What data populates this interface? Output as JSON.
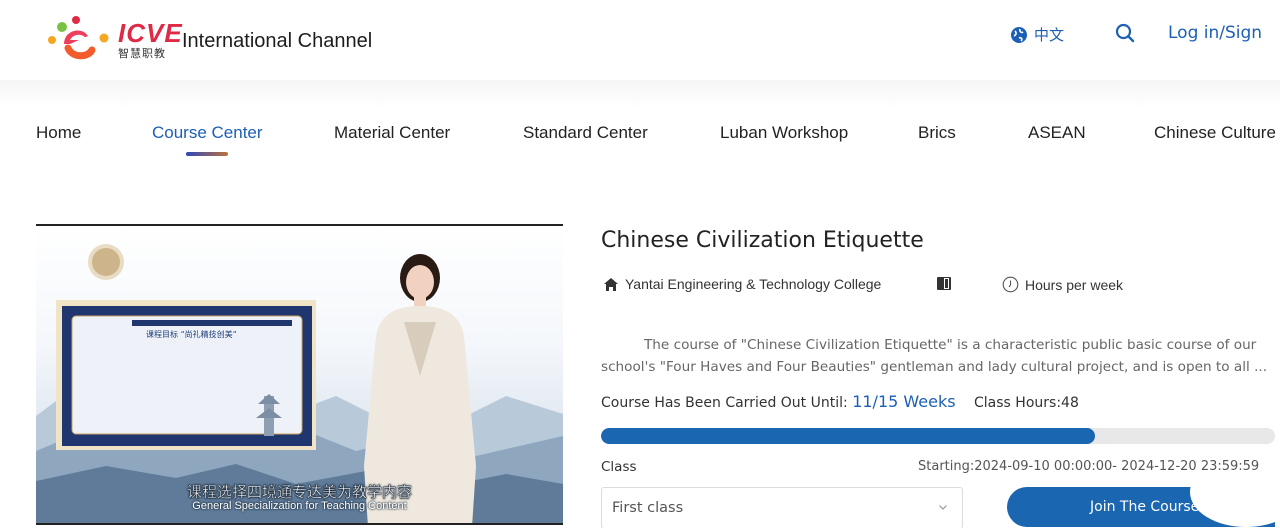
{
  "header": {
    "brand_name": "ICVE",
    "brand_sub": "智慧职教",
    "site_title": "International Channel",
    "language_label": "中文",
    "login_label": "Log in/Sign"
  },
  "nav": {
    "items": [
      {
        "label": "Home"
      },
      {
        "label": "Course Center",
        "active": true
      },
      {
        "label": "Material Center"
      },
      {
        "label": "Standard Center"
      },
      {
        "label": "Luban Workshop"
      },
      {
        "label": "Brics"
      },
      {
        "label": "ASEAN"
      },
      {
        "label": "Chinese Culture"
      }
    ]
  },
  "video": {
    "slide_title": "课程目标 “尚礼精技创美”",
    "subtitle_cn": "课程选择四境通专达美为教学内容",
    "subtitle_en": "General Specialization for Teaching Content"
  },
  "course": {
    "title": "Chinese Civilization Etiquette",
    "school": "Yantai Engineering & Technology College",
    "hours_per_week_label": "Hours per week",
    "description_line1": "The course of \"Chinese Civilization Etiquette\" is a characteristic public basic course of our",
    "description_line2": "school's \"Four Haves and Four Beauties\" gentleman and lady cultural project, and is open to all ...",
    "progress_label": "Course Has Been Carried Out Until:",
    "progress_weeks": "11/15 Weeks",
    "progress_fraction": 0.733,
    "class_hours": "Class Hours:48",
    "class_label": "Class",
    "dates": "Starting:2024-09-10 00:00:00- 2024-12-20 23:59:59",
    "class_selected": "First class",
    "join_label": "Join The Course"
  },
  "colors": {
    "accent": "#1d5fb4",
    "progress": "#1a66b0",
    "brand_red": "#e02a45"
  },
  "icons": [
    "logo-icon",
    "globe-icon",
    "search-icon",
    "home-icon",
    "book-icon",
    "clock-icon",
    "chevron-down-icon"
  ]
}
